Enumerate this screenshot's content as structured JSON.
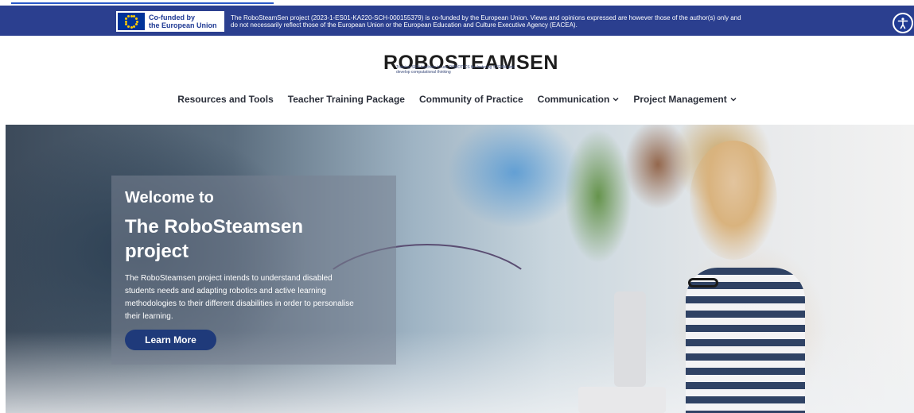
{
  "eu_bar": {
    "logo_line1": "Co-funded by",
    "logo_line2": "the European Union",
    "disclaimer_line1": "The RoboSteamSen project (2023-1-ES01-KA220-SCH-000155379) is co-funded by the European Union. Views and opinions expressed are however those of the author(s) only and",
    "disclaimer_line2": "do not necessarily reflect those of the European Union or the European Education and Culture Executive Agency (EACEA)."
  },
  "brand": {
    "name": "ROBOSTEAMSEN",
    "tagline_line1": "Training SEN teachers to use ROBOTICS for fostering STEAM and",
    "tagline_line2": "develop computational thinking"
  },
  "nav": {
    "items": [
      {
        "label": "Resources and Tools",
        "dropdown": false
      },
      {
        "label": "Teacher Training Package",
        "dropdown": false
      },
      {
        "label": "Community of Practice",
        "dropdown": false
      },
      {
        "label": "Communication",
        "dropdown": true
      },
      {
        "label": "Project Management",
        "dropdown": true
      }
    ]
  },
  "hero": {
    "welcome": "Welcome to",
    "title": "The RoboSteamsen project",
    "description": "The RoboSteamsen project intends to understand disabled students needs and adapting robotics and active learning methodologies to their different disabilities in order to personalise their learning.",
    "cta": "Learn More"
  },
  "colors": {
    "eu_bar_bg": "#2b3f8f",
    "cta_bg": "#1f3a7a",
    "nav_text": "#2b2f3a"
  },
  "icons": {
    "accessibility": "accessibility-icon",
    "eu_flag": "eu-flag-icon",
    "brand_mark": "robot-head-icon",
    "dropdown": "chevron-down-icon"
  }
}
